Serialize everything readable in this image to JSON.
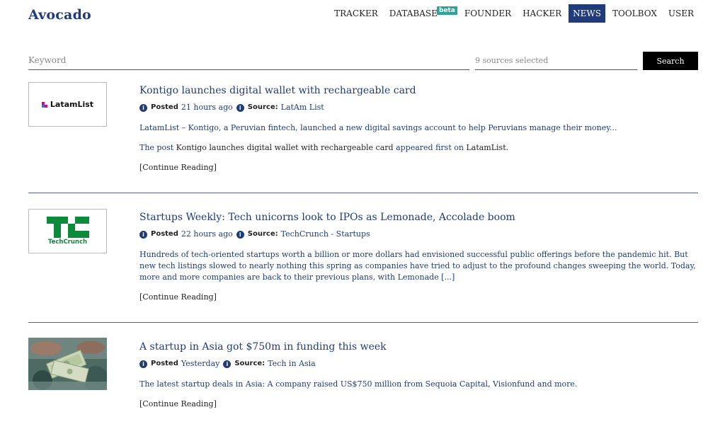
{
  "brand": "Avocado",
  "nav": {
    "items": [
      {
        "label": "TRACKER"
      },
      {
        "label": "DATABASE",
        "badge": "beta"
      },
      {
        "label": "FOUNDER"
      },
      {
        "label": "HACKER"
      },
      {
        "label": "NEWS",
        "active": true
      },
      {
        "label": "TOOLBOX"
      },
      {
        "label": "USER"
      }
    ]
  },
  "search": {
    "placeholder": "Keyword",
    "value": "",
    "sources": "9 sources selected",
    "button": "Search"
  },
  "articles": [
    {
      "thumb_text": "LatamList",
      "title": "Kontigo launches digital wallet with rechargeable card",
      "posted_label": "Posted",
      "posted": "21 hours ago",
      "source_label": "Source:",
      "source": "LatAm List",
      "excerpt": "LatamList – Kontigo, a Peruvian fintech, launched a new digital savings account to help Peruvians manage their money...",
      "post_line": {
        "the_post": "The post",
        "name": "Kontigo launches digital wallet with rechargeable card",
        "appeared": "appeared first on",
        "site": "LatamList."
      },
      "continue": "[Continue Reading]"
    },
    {
      "thumb_text": "TechCrunch",
      "title": "Startups Weekly: Tech unicorns look to IPOs as Lemonade, Accolade boom",
      "posted_label": "Posted",
      "posted": "22 hours ago",
      "source_label": "Source:",
      "source": "TechCrunch - Startups",
      "excerpt": "Hundreds of tech-oriented startups worth a billion or more dollars had envisioned successful public offerings before the pandemic hit. But new tech listings slowed to nearly nothing this spring as companies have tried to adjust to the profound changes sweeping the world. Today, more and more companies are back to their previous plans, with Lemonade [...]",
      "continue": "[Continue Reading]"
    },
    {
      "title": "A startup in Asia got $750m in funding this week",
      "posted_label": "Posted",
      "posted": "Yesterday",
      "source_label": "Source:",
      "source": "Tech in Asia",
      "excerpt": "The latest startup deals in Asia: A company raised US$750 million from Sequoia Capital, Visionfund and more.",
      "continue": "[Continue Reading]"
    }
  ],
  "colors": {
    "brand": "#1f3b7a",
    "beta": "#27a59a",
    "techcrunch_green": "#0a8a3a"
  },
  "icons": {
    "meta": "info-icon",
    "latamlist": "latamlist-logo",
    "techcrunch": "techcrunch-logo",
    "money_photo": "money-photo"
  }
}
